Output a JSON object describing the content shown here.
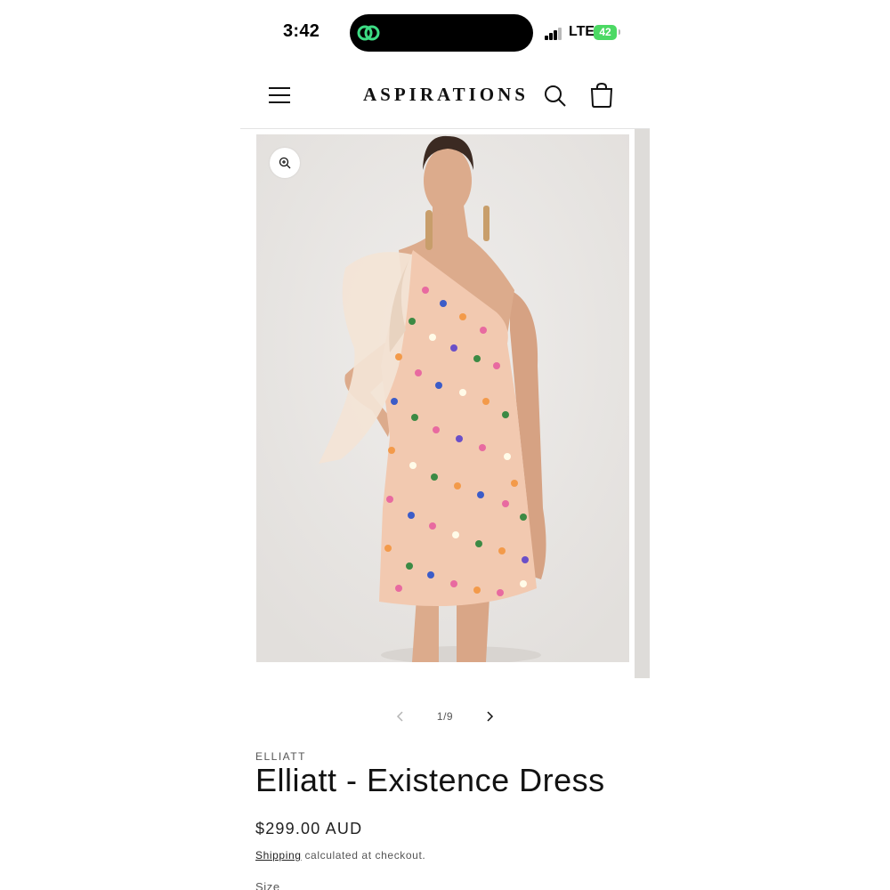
{
  "status_bar": {
    "time": "3:42",
    "network": "LTE",
    "battery": "42"
  },
  "header": {
    "logo": "ASPIRATIONS",
    "icons": [
      "hamburger-menu-icon",
      "search-icon",
      "shopping-bag-icon"
    ]
  },
  "gallery": {
    "image_alt": "Elliatt - Existence Dress",
    "counter": "1/9",
    "colors": {
      "backdrop": "#e9e7e6",
      "dress_base": "#f2c9b0"
    }
  },
  "product": {
    "vendor": "ELLIATT",
    "title": "Elliatt - Existence Dress",
    "price": "$299.00 AUD",
    "shipping_link": "Shipping",
    "shipping_text": " calculated at checkout.",
    "size_label": "Size"
  },
  "colors": {
    "battery": "#4cd964",
    "accent": "#121212"
  }
}
